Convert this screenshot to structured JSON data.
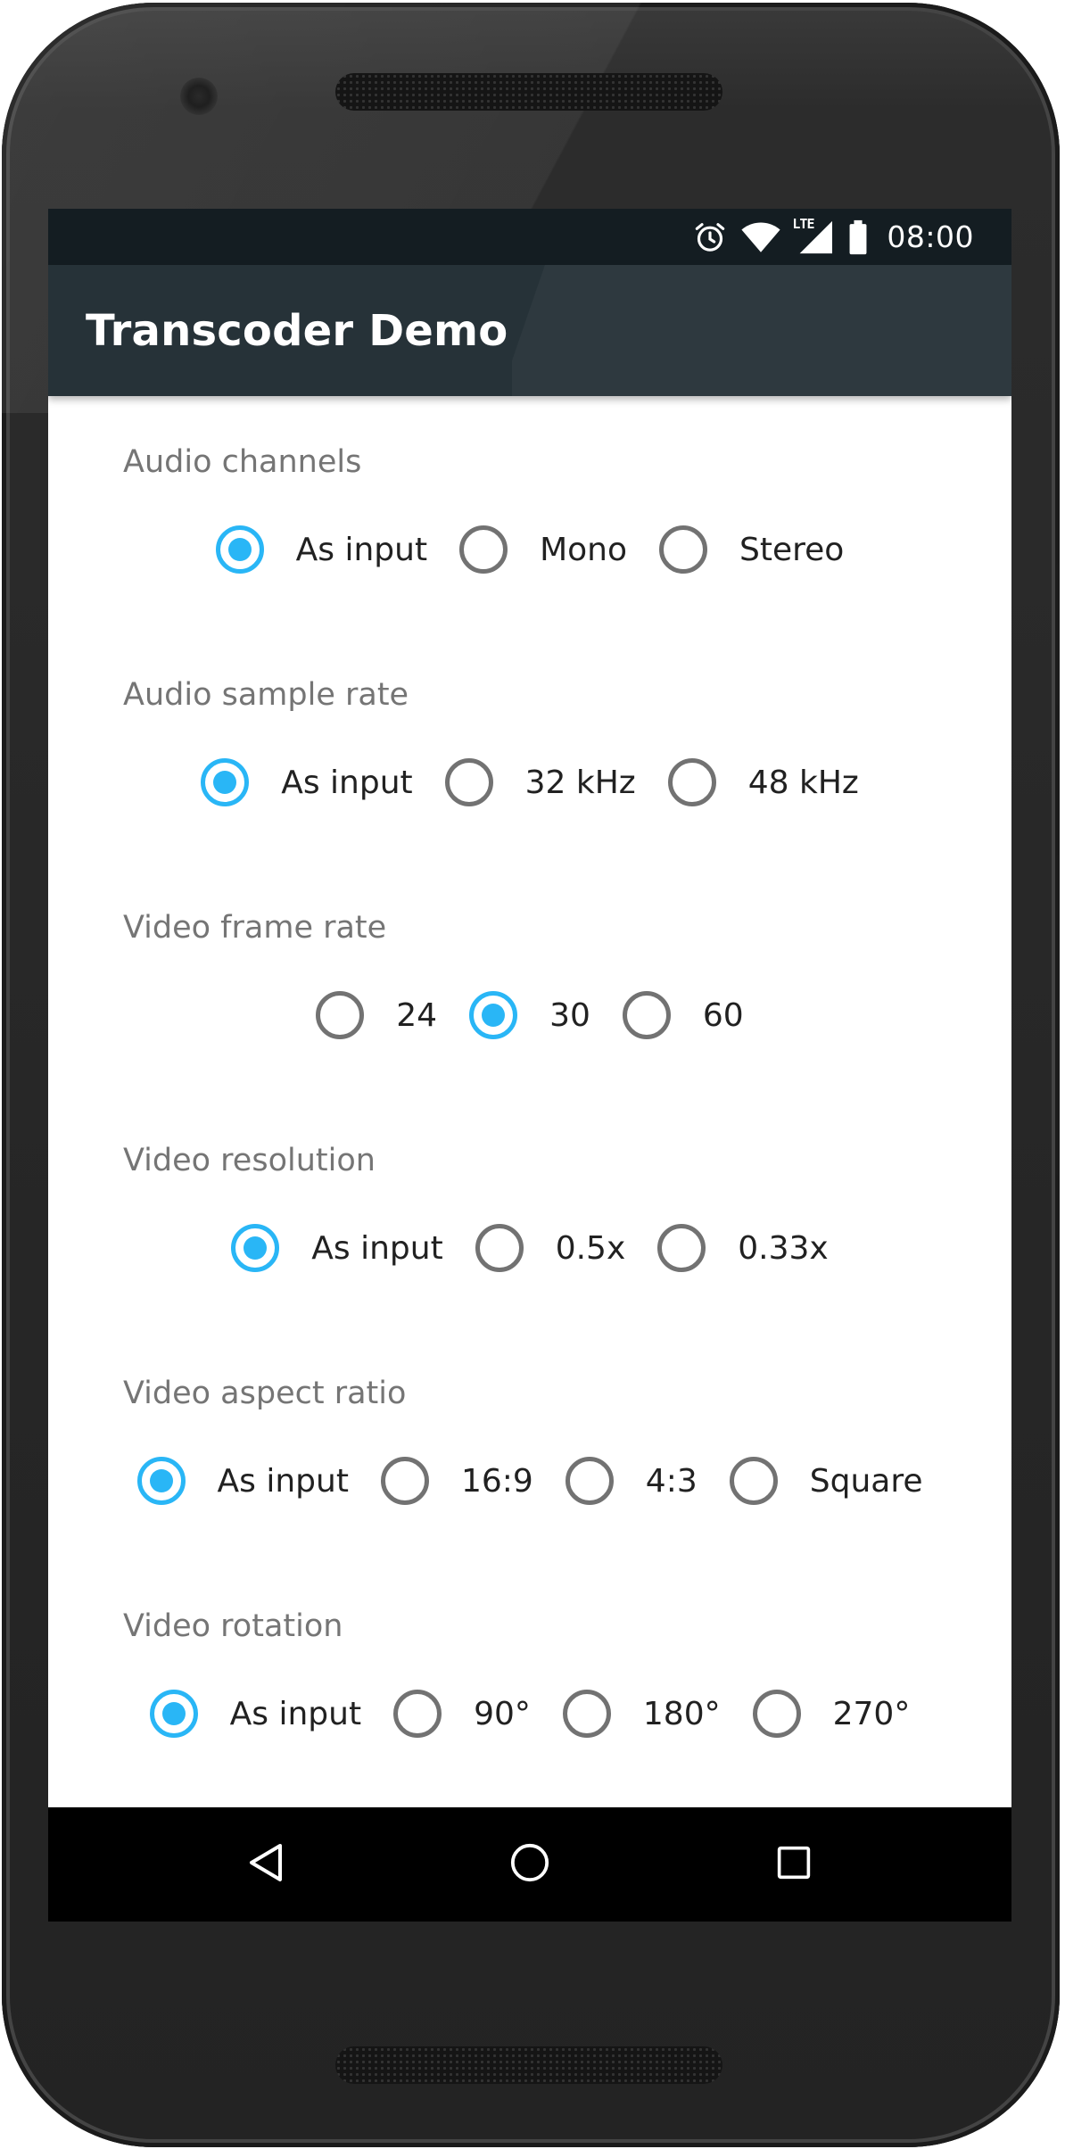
{
  "status_bar": {
    "time": "08:00",
    "icons": [
      "alarm-icon",
      "wifi-icon",
      "lte-signal-icon",
      "battery-icon"
    ],
    "lte_label": "LTE"
  },
  "app_bar": {
    "title": "Transcoder Demo",
    "color": "#263238"
  },
  "accent_color": "#29b6f6",
  "sections": [
    {
      "label": "Audio channels",
      "options": [
        {
          "label": "As input",
          "checked": true
        },
        {
          "label": "Mono",
          "checked": false
        },
        {
          "label": "Stereo",
          "checked": false
        }
      ]
    },
    {
      "label": "Audio sample rate",
      "options": [
        {
          "label": "As input",
          "checked": true
        },
        {
          "label": "32 kHz",
          "checked": false
        },
        {
          "label": "48 kHz",
          "checked": false
        }
      ]
    },
    {
      "label": "Video frame rate",
      "options": [
        {
          "label": "24",
          "checked": false
        },
        {
          "label": "30",
          "checked": true
        },
        {
          "label": "60",
          "checked": false
        }
      ]
    },
    {
      "label": "Video resolution",
      "options": [
        {
          "label": "As input",
          "checked": true
        },
        {
          "label": "0.5x",
          "checked": false
        },
        {
          "label": "0.33x",
          "checked": false
        }
      ]
    },
    {
      "label": "Video aspect ratio",
      "options": [
        {
          "label": "As input",
          "checked": true
        },
        {
          "label": "16:9",
          "checked": false
        },
        {
          "label": "4:3",
          "checked": false
        },
        {
          "label": "Square",
          "checked": false
        }
      ]
    },
    {
      "label": "Video rotation",
      "options": [
        {
          "label": "As input",
          "checked": true
        },
        {
          "label": "90°",
          "checked": false
        },
        {
          "label": "180°",
          "checked": false
        },
        {
          "label": "270°",
          "checked": false
        }
      ]
    }
  ],
  "nav_bar": {
    "buttons": [
      "back-icon",
      "home-icon",
      "recents-icon"
    ]
  }
}
